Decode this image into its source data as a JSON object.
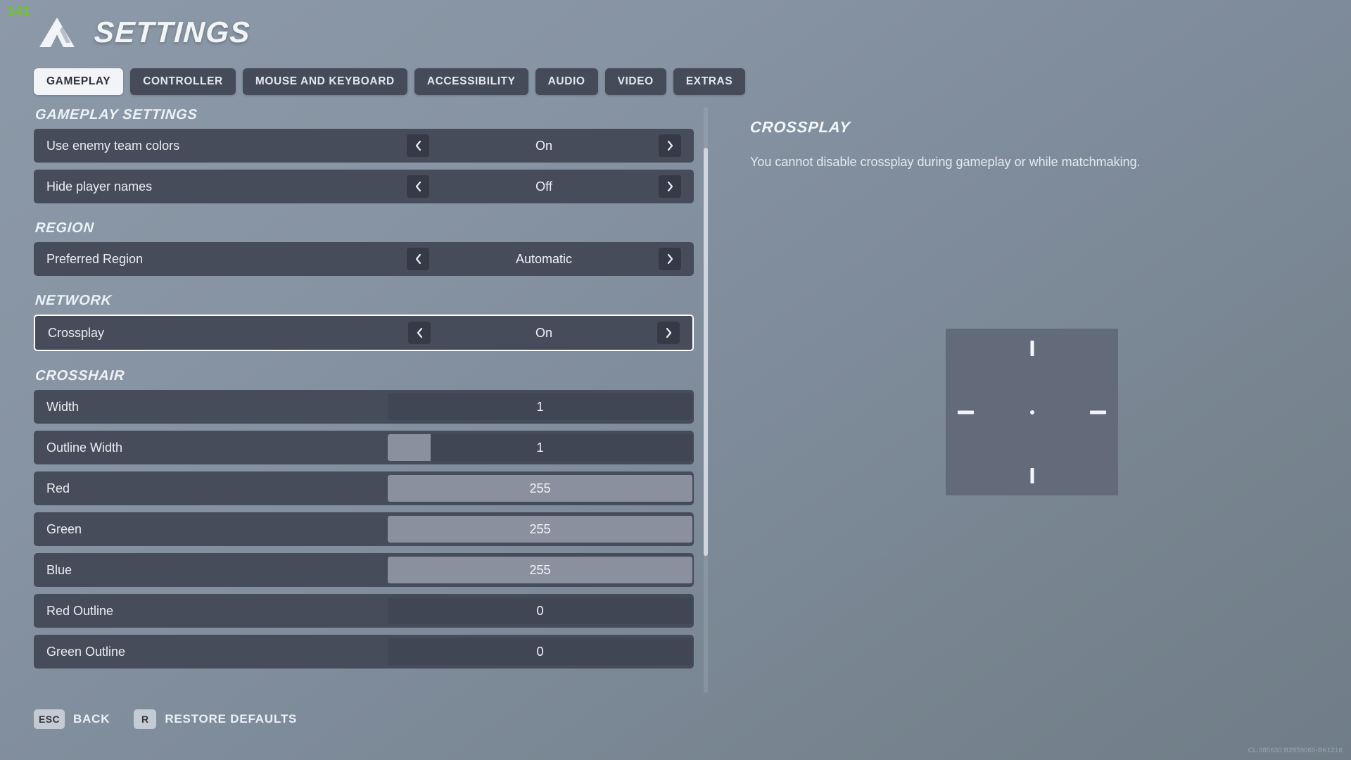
{
  "fps_counter": "141",
  "header": {
    "title": "SETTINGS",
    "logo_icon": "mountain-logo-icon"
  },
  "tabs": [
    {
      "label": "GAMEPLAY",
      "active": true
    },
    {
      "label": "CONTROLLER",
      "active": false
    },
    {
      "label": "MOUSE AND KEYBOARD",
      "active": false
    },
    {
      "label": "ACCESSIBILITY",
      "active": false
    },
    {
      "label": "AUDIO",
      "active": false
    },
    {
      "label": "VIDEO",
      "active": false
    },
    {
      "label": "EXTRAS",
      "active": false
    }
  ],
  "groups": [
    {
      "title": "GAMEPLAY SETTINGS",
      "rows": [
        {
          "type": "option",
          "label": "Use enemy team colors",
          "value": "On",
          "left_arrow": "‹",
          "right_arrow": "›"
        },
        {
          "type": "option",
          "label": "Hide player names",
          "value": "Off",
          "left_arrow": "‹",
          "right_arrow": "›"
        }
      ]
    },
    {
      "title": "REGION",
      "rows": [
        {
          "type": "option",
          "label": "Preferred Region",
          "value": "Automatic",
          "left_arrow": "‹",
          "right_arrow": "›"
        }
      ]
    },
    {
      "title": "NETWORK",
      "rows": [
        {
          "type": "option",
          "label": "Crossplay",
          "value": "On",
          "focused": true,
          "left_arrow": "‹",
          "right_arrow": "›"
        }
      ]
    },
    {
      "title": "CROSSHAIR",
      "rows": [
        {
          "type": "slider",
          "label": "Width",
          "value": "1",
          "fill_percent": 0
        },
        {
          "type": "slider",
          "label": "Outline Width",
          "value": "1",
          "fill_percent": 14
        },
        {
          "type": "slider",
          "label": "Red",
          "value": "255",
          "fill_percent": 100
        },
        {
          "type": "slider",
          "label": "Green",
          "value": "255",
          "fill_percent": 100
        },
        {
          "type": "slider",
          "label": "Blue",
          "value": "255",
          "fill_percent": 100
        },
        {
          "type": "slider",
          "label": "Red Outline",
          "value": "0",
          "fill_percent": 0
        },
        {
          "type": "slider",
          "label": "Green Outline",
          "value": "0",
          "fill_percent": 0
        }
      ]
    }
  ],
  "info_panel": {
    "title": "CROSSPLAY",
    "description": "You cannot disable crossplay during gameplay or while matchmaking."
  },
  "crosshair_preview": {
    "color": "#f4f6f9",
    "background": "#636b7a"
  },
  "bottom_bar": [
    {
      "key": "ESC",
      "label": "BACK"
    },
    {
      "key": "R",
      "label": "RESTORE DEFAULTS"
    }
  ],
  "build_string": "CL:385630:B2859060-BK1216",
  "colors": {
    "row_bg": "#474c5b",
    "arrow_bg": "#363a46",
    "tab_bg": "#464b5a",
    "tab_active_bg": "#f2f4f7",
    "slider_fill": "#8a909e",
    "fps_green": "#6ec52a"
  }
}
